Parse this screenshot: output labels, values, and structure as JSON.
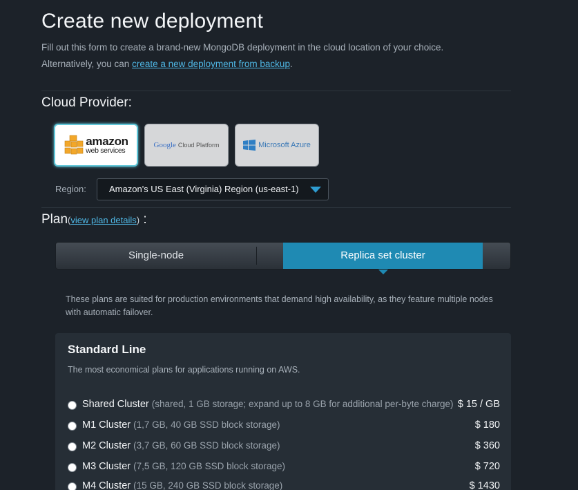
{
  "header": {
    "title": "Create new deployment",
    "intro_line1": "Fill out this form to create a brand-new MongoDB deployment in the cloud location of your choice.",
    "intro_line2_prefix": "Alternatively, you can ",
    "intro_link": "create a new deployment from backup",
    "intro_line2_suffix": "."
  },
  "cloud_provider": {
    "title": "Cloud Provider:",
    "providers": [
      {
        "label_main": "amazon",
        "label_sub": "web services",
        "selected": true
      },
      {
        "label_google": "Google",
        "label_rest": "Cloud Platform",
        "selected": false
      },
      {
        "label": "Microsoft Azure",
        "selected": false
      }
    ],
    "region_label": "Region:",
    "region_value": "Amazon's US East (Virginia) Region (us-east-1)"
  },
  "plan": {
    "title": "Plan",
    "paren_open": "(",
    "link": "view plan details",
    "paren_close": ")",
    "colon": " :",
    "tabs": [
      {
        "label": "Single-node",
        "active": false
      },
      {
        "label": "Replica set cluster",
        "active": true
      }
    ],
    "description": "These plans are suited for production environments that demand high availability, as they feature multiple nodes with automatic failover."
  },
  "standard_line": {
    "title": "Standard Line",
    "subtitle": "The most economical plans for applications running on AWS.",
    "options": [
      {
        "name": "Shared Cluster",
        "detail": "(shared, 1 GB storage; expand up to 8 GB for additional per-byte charge)",
        "price": "$ 15 / GB"
      },
      {
        "name": "M1 Cluster",
        "detail": "(1,7 GB, 40 GB SSD block storage)",
        "price": "$ 180"
      },
      {
        "name": "M2 Cluster",
        "detail": "(3,7 GB, 60 GB SSD block storage)",
        "price": "$ 360"
      },
      {
        "name": "M3 Cluster",
        "detail": "(7,5 GB, 120 GB SSD block storage)",
        "price": "$ 720"
      },
      {
        "name": "M4 Cluster",
        "detail": "(15 GB, 240 GB SSD block storage)",
        "price": "$ 1430"
      }
    ]
  },
  "colors": {
    "background": "#1c2229",
    "accent": "#1f8ab3",
    "link": "#4fb8e6",
    "aws_orange": "#f2a72a"
  },
  "icons": {
    "aws": "aws-cubes-logo-icon",
    "azure": "windows-logo-icon",
    "region_caret": "chevron-down-icon"
  }
}
